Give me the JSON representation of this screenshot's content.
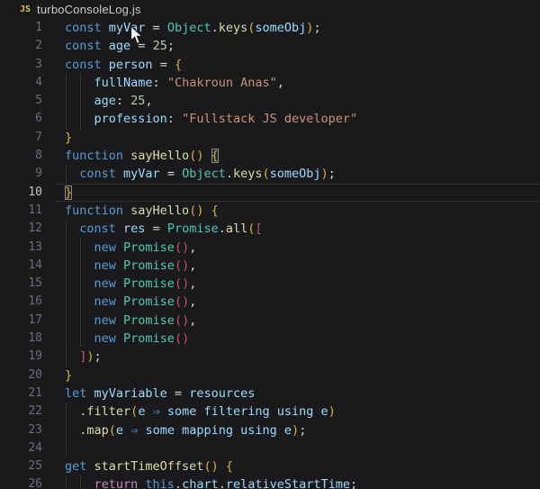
{
  "window": {
    "file_icon_label": "JS",
    "title": "turboConsoleLog.js",
    "file_icon_color": "#e3c53f",
    "file_name_color": "#cccccc"
  },
  "editor": {
    "background": "#1a1a1c",
    "active_line": 10,
    "palette": {
      "kw": "#569cd6",
      "var": "#9cdcfe",
      "cls": "#4ec9b0",
      "fn": "#dcdcaa",
      "str": "#ce9178",
      "num": "#b5cea8",
      "pl": "#d4d4d4",
      "g": "#d7b43e",
      "pk": "#cd4d79",
      "ct": "#c586c0"
    },
    "lines": [
      {
        "n": 1,
        "tokens": [
          {
            "t": "const ",
            "c": "kw"
          },
          {
            "t": "myVar",
            "c": "var"
          },
          {
            "t": " = ",
            "c": "pl"
          },
          {
            "t": "Object",
            "c": "cls"
          },
          {
            "t": ".",
            "c": "pl"
          },
          {
            "t": "keys",
            "c": "fn"
          },
          {
            "t": "(",
            "c": "g"
          },
          {
            "t": "someObj",
            "c": "var"
          },
          {
            "t": ")",
            "c": "g"
          },
          {
            "t": ";",
            "c": "pl"
          }
        ]
      },
      {
        "n": 2,
        "tokens": [
          {
            "t": "const ",
            "c": "kw"
          },
          {
            "t": "age",
            "c": "var"
          },
          {
            "t": " = ",
            "c": "pl"
          },
          {
            "t": "25",
            "c": "num"
          },
          {
            "t": ";",
            "c": "pl"
          }
        ]
      },
      {
        "n": 3,
        "tokens": [
          {
            "t": "const ",
            "c": "kw"
          },
          {
            "t": "person",
            "c": "var"
          },
          {
            "t": " = ",
            "c": "pl"
          },
          {
            "t": "{",
            "c": "g"
          }
        ]
      },
      {
        "n": 4,
        "guides": [
          0,
          2
        ],
        "tokens": [
          {
            "t": "    ",
            "c": "pl"
          },
          {
            "t": "fullName",
            "c": "var"
          },
          {
            "t": ": ",
            "c": "pl"
          },
          {
            "t": "\"Chakroun Anas\"",
            "c": "str"
          },
          {
            "t": ",",
            "c": "pl"
          }
        ]
      },
      {
        "n": 5,
        "guides": [
          0,
          2
        ],
        "tokens": [
          {
            "t": "    ",
            "c": "pl"
          },
          {
            "t": "age",
            "c": "var"
          },
          {
            "t": ": ",
            "c": "pl"
          },
          {
            "t": "25",
            "c": "num"
          },
          {
            "t": ",",
            "c": "pl"
          }
        ]
      },
      {
        "n": 6,
        "guides": [
          0,
          2
        ],
        "tokens": [
          {
            "t": "    ",
            "c": "pl"
          },
          {
            "t": "profession",
            "c": "var"
          },
          {
            "t": ": ",
            "c": "pl"
          },
          {
            "t": "\"Fullstack JS developer\"",
            "c": "str"
          }
        ]
      },
      {
        "n": 7,
        "tokens": [
          {
            "t": "}",
            "c": "g"
          }
        ]
      },
      {
        "n": 8,
        "tokens": [
          {
            "t": "function ",
            "c": "kw"
          },
          {
            "t": "sayHello",
            "c": "fn"
          },
          {
            "t": "()",
            "c": "g"
          },
          {
            "t": " ",
            "c": "pl"
          },
          {
            "t": "{",
            "c": "g",
            "box": true
          }
        ]
      },
      {
        "n": 9,
        "guides": [
          0
        ],
        "tokens": [
          {
            "t": "  ",
            "c": "pl"
          },
          {
            "t": "const ",
            "c": "kw"
          },
          {
            "t": "myVar",
            "c": "var"
          },
          {
            "t": " = ",
            "c": "pl"
          },
          {
            "t": "Object",
            "c": "cls"
          },
          {
            "t": ".",
            "c": "pl"
          },
          {
            "t": "keys",
            "c": "fn"
          },
          {
            "t": "(",
            "c": "g"
          },
          {
            "t": "someObj",
            "c": "var"
          },
          {
            "t": ")",
            "c": "g"
          },
          {
            "t": ";",
            "c": "pl"
          }
        ]
      },
      {
        "n": 10,
        "active": true,
        "tokens": [
          {
            "t": "}",
            "c": "g",
            "box": true
          }
        ]
      },
      {
        "n": 11,
        "tokens": [
          {
            "t": "function ",
            "c": "kw"
          },
          {
            "t": "sayHello",
            "c": "fn"
          },
          {
            "t": "()",
            "c": "g"
          },
          {
            "t": " ",
            "c": "pl"
          },
          {
            "t": "{",
            "c": "g"
          }
        ]
      },
      {
        "n": 12,
        "guides": [
          0
        ],
        "tokens": [
          {
            "t": "  ",
            "c": "pl"
          },
          {
            "t": "const ",
            "c": "kw"
          },
          {
            "t": "res",
            "c": "var"
          },
          {
            "t": " = ",
            "c": "pl"
          },
          {
            "t": "Promise",
            "c": "cls"
          },
          {
            "t": ".",
            "c": "pl"
          },
          {
            "t": "all",
            "c": "fn"
          },
          {
            "t": "(",
            "c": "g"
          },
          {
            "t": "[",
            "c": "pk"
          }
        ]
      },
      {
        "n": 13,
        "guides": [
          0,
          2
        ],
        "tokens": [
          {
            "t": "    ",
            "c": "pl"
          },
          {
            "t": "new ",
            "c": "kw"
          },
          {
            "t": "Promise",
            "c": "cls"
          },
          {
            "t": "()",
            "c": "pk"
          },
          {
            "t": ",",
            "c": "pl"
          }
        ]
      },
      {
        "n": 14,
        "guides": [
          0,
          2
        ],
        "tokens": [
          {
            "t": "    ",
            "c": "pl"
          },
          {
            "t": "new ",
            "c": "kw"
          },
          {
            "t": "Promise",
            "c": "cls"
          },
          {
            "t": "()",
            "c": "pk"
          },
          {
            "t": ",",
            "c": "pl"
          }
        ]
      },
      {
        "n": 15,
        "guides": [
          0,
          2
        ],
        "tokens": [
          {
            "t": "    ",
            "c": "pl"
          },
          {
            "t": "new ",
            "c": "kw"
          },
          {
            "t": "Promise",
            "c": "cls"
          },
          {
            "t": "()",
            "c": "pk"
          },
          {
            "t": ",",
            "c": "pl"
          }
        ]
      },
      {
        "n": 16,
        "guides": [
          0,
          2
        ],
        "tokens": [
          {
            "t": "    ",
            "c": "pl"
          },
          {
            "t": "new ",
            "c": "kw"
          },
          {
            "t": "Promise",
            "c": "cls"
          },
          {
            "t": "()",
            "c": "pk"
          },
          {
            "t": ",",
            "c": "pl"
          }
        ]
      },
      {
        "n": 17,
        "guides": [
          0,
          2
        ],
        "tokens": [
          {
            "t": "    ",
            "c": "pl"
          },
          {
            "t": "new ",
            "c": "kw"
          },
          {
            "t": "Promise",
            "c": "cls"
          },
          {
            "t": "()",
            "c": "pk"
          },
          {
            "t": ",",
            "c": "pl"
          }
        ]
      },
      {
        "n": 18,
        "guides": [
          0,
          2
        ],
        "tokens": [
          {
            "t": "    ",
            "c": "pl"
          },
          {
            "t": "new ",
            "c": "kw"
          },
          {
            "t": "Promise",
            "c": "cls"
          },
          {
            "t": "()",
            "c": "pk"
          }
        ]
      },
      {
        "n": 19,
        "guides": [
          0
        ],
        "tokens": [
          {
            "t": "  ",
            "c": "pl"
          },
          {
            "t": "]",
            "c": "pk"
          },
          {
            "t": ")",
            "c": "g"
          },
          {
            "t": ";",
            "c": "pl"
          }
        ]
      },
      {
        "n": 20,
        "tokens": [
          {
            "t": "}",
            "c": "g"
          }
        ]
      },
      {
        "n": 21,
        "tokens": [
          {
            "t": "let ",
            "c": "kw"
          },
          {
            "t": "myVariable",
            "c": "var"
          },
          {
            "t": " = ",
            "c": "pl"
          },
          {
            "t": "resources",
            "c": "var"
          }
        ]
      },
      {
        "n": 22,
        "guides": [
          0
        ],
        "tokens": [
          {
            "t": "  .",
            "c": "pl"
          },
          {
            "t": "filter",
            "c": "fn"
          },
          {
            "t": "(",
            "c": "g"
          },
          {
            "t": "e",
            "c": "var"
          },
          {
            "t": " ",
            "c": "pl"
          },
          {
            "t": "⇒",
            "c": "kw"
          },
          {
            "t": " ",
            "c": "pl"
          },
          {
            "t": "some filtering using e",
            "c": "var"
          },
          {
            "t": ")",
            "c": "g"
          }
        ]
      },
      {
        "n": 23,
        "guides": [
          0
        ],
        "tokens": [
          {
            "t": "  .",
            "c": "pl"
          },
          {
            "t": "map",
            "c": "fn"
          },
          {
            "t": "(",
            "c": "g"
          },
          {
            "t": "e",
            "c": "var"
          },
          {
            "t": " ",
            "c": "pl"
          },
          {
            "t": "⇒",
            "c": "kw"
          },
          {
            "t": " ",
            "c": "pl"
          },
          {
            "t": "some mapping using e",
            "c": "var"
          },
          {
            "t": ")",
            "c": "g"
          },
          {
            "t": ";",
            "c": "pl"
          }
        ]
      },
      {
        "n": 24,
        "guides": [
          0
        ],
        "tokens": []
      },
      {
        "n": 25,
        "tokens": [
          {
            "t": "get ",
            "c": "kw"
          },
          {
            "t": "startTimeOffset",
            "c": "fn"
          },
          {
            "t": "()",
            "c": "g"
          },
          {
            "t": " ",
            "c": "pl"
          },
          {
            "t": "{",
            "c": "g"
          }
        ]
      },
      {
        "n": 26,
        "guides": [
          0,
          2
        ],
        "tokens": [
          {
            "t": "    ",
            "c": "pl"
          },
          {
            "t": "return ",
            "c": "ct"
          },
          {
            "t": "this",
            "c": "kw"
          },
          {
            "t": ".",
            "c": "pl"
          },
          {
            "t": "chart",
            "c": "var"
          },
          {
            "t": ".",
            "c": "pl"
          },
          {
            "t": "relativeStartTime",
            "c": "var"
          },
          {
            "t": ";",
            "c": "pl"
          }
        ]
      }
    ]
  }
}
